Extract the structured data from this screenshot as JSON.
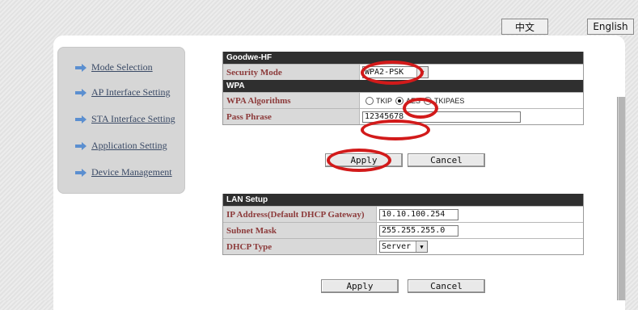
{
  "lang": {
    "chinese": "中文",
    "english": "English"
  },
  "sidebar": {
    "items": [
      {
        "label": "Mode Selection"
      },
      {
        "label": "AP Interface Setting"
      },
      {
        "label": "STA Interface Setting"
      },
      {
        "label": "Application Setting"
      },
      {
        "label": "Device Management"
      }
    ]
  },
  "wireless": {
    "header": "Goodwe-HF",
    "security_mode_label": "Security Mode",
    "security_mode_value": "WPA2-PSK",
    "wpa_header": "WPA",
    "wpa_algorithms_label": "WPA Algorithms",
    "algorithms": [
      {
        "label": "TKIP",
        "checked": false
      },
      {
        "label": "AES",
        "checked": true
      },
      {
        "label": "TKIPAES",
        "checked": false
      }
    ],
    "pass_phrase_label": "Pass Phrase",
    "pass_phrase_value": "12345678",
    "apply_label": "Apply",
    "cancel_label": "Cancel"
  },
  "lan": {
    "header": "LAN Setup",
    "ip_label": "IP Address(Default DHCP Gateway)",
    "ip_value": "10.10.100.254",
    "mask_label": "Subnet Mask",
    "mask_value": "255.255.255.0",
    "dhcp_label": "DHCP Type",
    "dhcp_value": "Server",
    "apply_label": "Apply",
    "cancel_label": "Cancel"
  },
  "colors": {
    "highlight_ring": "#d21a1a",
    "header_bg": "#2f2f2f",
    "label_text": "#8c3a3a"
  }
}
